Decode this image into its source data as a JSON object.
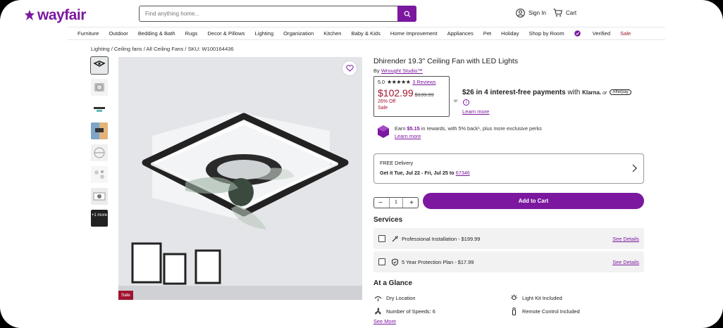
{
  "header": {
    "logo": "wayfair",
    "search_placeholder": "Find anything home...",
    "sign_in": "Sign In",
    "cart": "Cart"
  },
  "nav": [
    "Furniture",
    "Outdoor",
    "Bedding & Bath",
    "Rugs",
    "Decor & Pillows",
    "Lighting",
    "Organization",
    "Kitchen",
    "Baby & Kids",
    "Home Improvement",
    "Appliances",
    "Pet",
    "Holiday",
    "Shop by Room",
    "Verified",
    "Sale"
  ],
  "breadcrumb": "Lighting / Ceiling fans / All Ceiling Fans / SKU: W100164436",
  "gallery": {
    "more_label": "+1 more",
    "sale_badge": "Sale"
  },
  "product": {
    "title": "Dhirender 19.3\" Ceiling Fan with LED Lights",
    "by_prefix": "By",
    "brand": "Wrought Studio™",
    "rating": "5.0",
    "stars": "★★★★★",
    "reviews": "3 Reviews",
    "price": "$102.99",
    "old_price": "$139.99",
    "discount": "26% Off",
    "sale_label": "Sale",
    "or": "or",
    "installment_amount": "$26",
    "installment_text": " in 4 interest-free payments",
    "with": " with ",
    "klarna": "Klarna.",
    "or2": " or ",
    "afterpay": "Afterpay",
    "learn_more": "Learn more",
    "rewards_prefix": "Earn ",
    "rewards_amount": "$5.15",
    "rewards_suffix": " in rewards, with 5% back¹, plus more exclusive perks",
    "rewards_learn_more": "Learn more"
  },
  "delivery": {
    "label": "FREE Delivery",
    "get_it": "Get it Tue, Jul 22 - Fri, Jul 25 to ",
    "zip": "67346"
  },
  "cart": {
    "qty": "1",
    "minus": "−",
    "plus": "+",
    "add": "Add to Cart"
  },
  "services": {
    "heading": "Services",
    "items": [
      {
        "label": "Professional Installation - $199.99",
        "link": "See Details"
      },
      {
        "label": "5 Year Protection Plan - $17.99",
        "link": "See Details"
      }
    ]
  },
  "glance": {
    "heading": "At a Glance",
    "features": [
      "Dry Location",
      "Light Kit Included",
      "Number of Speeds: 6",
      "Remote Control Included"
    ],
    "see_more": "See More"
  },
  "colors": {
    "brand": "#7b189f",
    "sale": "#a0132f"
  }
}
